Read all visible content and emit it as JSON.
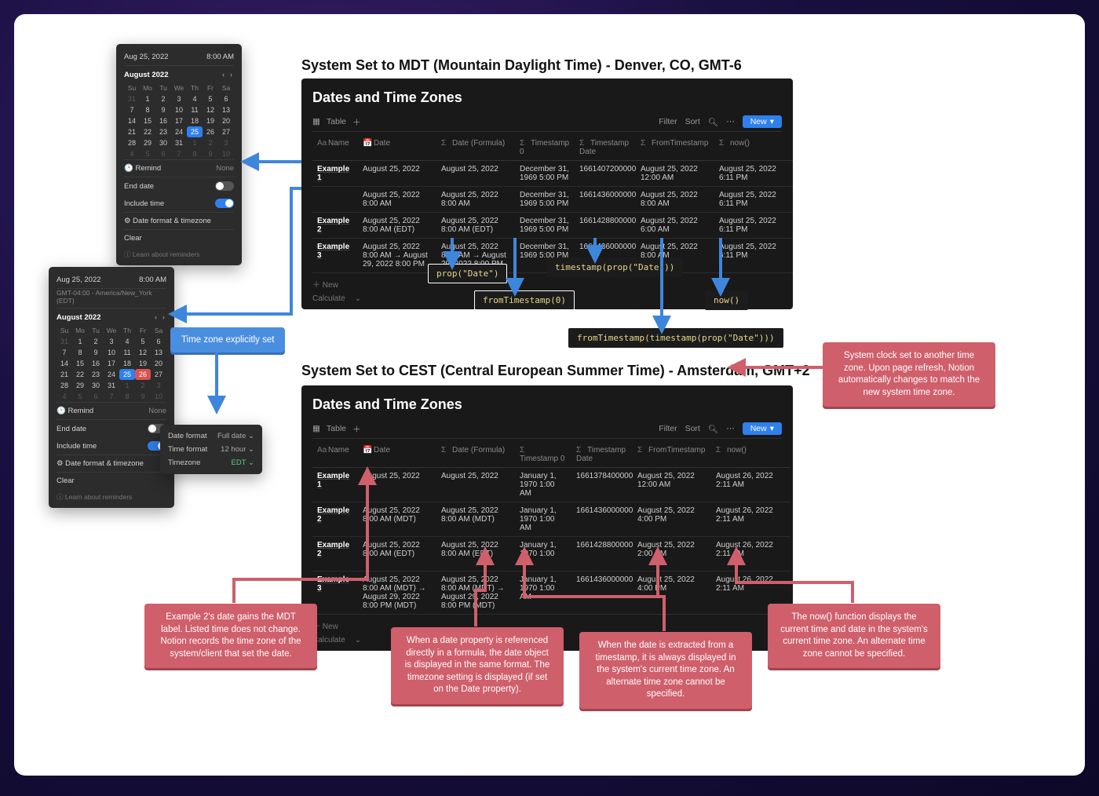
{
  "titles": {
    "mdt": "System Set to MDT (Mountain Daylight Time) - Denver, CO, GMT-6",
    "cest": "System Set to CEST (Central European Summer Time) - Amsterdam, GMT+2"
  },
  "db": {
    "title": "Dates and Time Zones",
    "view": "Table",
    "toolbar": {
      "filter": "Filter",
      "sort": "Sort",
      "new": "New"
    },
    "headers": {
      "name": "Name",
      "date": "Date",
      "date_formula": "Date (Formula)",
      "ts0": "Timestamp 0",
      "ts_date": "Timestamp Date",
      "from_ts": "FromTimestamp",
      "now": "now()"
    },
    "footer": {
      "new": "New",
      "calc": "Calculate"
    }
  },
  "mdt_rows": [
    {
      "name": "Example 1",
      "date": "August 25, 2022",
      "date_formula": "August 25, 2022",
      "ts0": "December 31, 1969 5:00 PM",
      "ts_date": "1661407200000",
      "from_ts": "August 25, 2022 12:00 AM",
      "now": "August 25, 2022 6:11 PM"
    },
    {
      "name": "",
      "date": "August 25, 2022 8:00 AM",
      "date_formula": "August 25, 2022 8:00 AM",
      "ts0": "December 31, 1969 5:00 PM",
      "ts_date": "1661436000000",
      "from_ts": "August 25, 2022 8:00 AM",
      "now": "August 25, 2022 6:11 PM"
    },
    {
      "name": "Example 2",
      "date": "August 25, 2022 8:00 AM (EDT)",
      "date_formula": "August 25, 2022 8:00 AM (EDT)",
      "ts0": "December 31, 1969 5:00 PM",
      "ts_date": "1661428800000",
      "from_ts": "August 25, 2022 6:00 AM",
      "now": "August 25, 2022 6:11 PM"
    },
    {
      "name": "Example 3",
      "date": "August 25, 2022 8:00 AM → August 29, 2022 8:00 PM",
      "date_formula": "August 25, 2022 8:00 AM → August 29, 2022 8:00 PM",
      "ts0": "December 31, 1969 5:00 PM",
      "ts_date": "1661436000000",
      "from_ts": "August 25, 2022 8:00 AM",
      "now": "August 25, 2022 6:11 PM"
    }
  ],
  "cest_rows": [
    {
      "name": "Example 1",
      "date": "August 25, 2022",
      "date_formula": "August 25, 2022",
      "ts0": "January 1, 1970 1:00 AM",
      "ts_date": "1661378400000",
      "from_ts": "August 25, 2022 12:00 AM",
      "now": "August 26, 2022 2:11 AM"
    },
    {
      "name": "Example 2",
      "date": "August 25, 2022 8:00 AM (MDT)",
      "date_formula": "August 25, 2022 8:00 AM (MDT)",
      "ts0": "January 1, 1970 1:00 AM",
      "ts_date": "1661436000000",
      "from_ts": "August 25, 2022 4:00 PM",
      "now": "August 26, 2022 2:11 AM"
    },
    {
      "name": "Example 2",
      "date": "August 25, 2022 8:00 AM (EDT)",
      "date_formula": "August 25, 2022 8:00 AM (EDT)",
      "ts0": "January 1, 1970 1:00 AM",
      "ts_date": "1661428800000",
      "from_ts": "August 25, 2022 2:00 PM",
      "now": "August 26, 2022 2:11 AM"
    },
    {
      "name": "Example 3",
      "date": "August 25, 2022 8:00 AM (MDT) → August 29, 2022 8:00 PM (MDT)",
      "date_formula": "August 25, 2022 8:00 AM (MDT) → August 29, 2022 8:00 PM (MDT)",
      "ts0": "January 1, 1970 1:00 AM",
      "ts_date": "1661436000000",
      "from_ts": "August 25, 2022 4:00 PM",
      "now": "August 26, 2022 2:11 AM"
    }
  ],
  "picker1": {
    "date": "Aug 25, 2022",
    "time": "8:00 AM",
    "month": "August 2022",
    "remind_label": "Remind",
    "remind_value": "None",
    "end_date": "End date",
    "include_time": "Include time",
    "fmt": "Date format & timezone",
    "clear": "Clear",
    "learn": "Learn about reminders",
    "dow": [
      "Su",
      "Mo",
      "Tu",
      "We",
      "Th",
      "Fr",
      "Sa"
    ],
    "grid": [
      [
        "31",
        "1",
        "2",
        "3",
        "4",
        "5",
        "6"
      ],
      [
        "7",
        "8",
        "9",
        "10",
        "11",
        "12",
        "13"
      ],
      [
        "14",
        "15",
        "16",
        "17",
        "18",
        "19",
        "20"
      ],
      [
        "21",
        "22",
        "23",
        "24",
        "25",
        "26",
        "27"
      ],
      [
        "28",
        "29",
        "30",
        "31",
        "1",
        "2",
        "3"
      ],
      [
        "4",
        "5",
        "6",
        "7",
        "8",
        "9",
        "10"
      ]
    ],
    "selected": "25"
  },
  "picker2": {
    "date": "Aug 25, 2022",
    "time": "8:00 AM",
    "tzline": "GMT-04:00 - America/New_York (EDT)",
    "month": "August 2022",
    "remind_label": "Remind",
    "remind_value": "None",
    "end_date": "End date",
    "include_time": "Include time",
    "fmt": "Date format & timezone",
    "clear": "Clear",
    "learn": "Learn about reminders",
    "dow": [
      "Su",
      "Mo",
      "Tu",
      "We",
      "Th",
      "Fr",
      "Sa"
    ],
    "grid": [
      [
        "31",
        "1",
        "2",
        "3",
        "4",
        "5",
        "6"
      ],
      [
        "7",
        "8",
        "9",
        "10",
        "11",
        "12",
        "13"
      ],
      [
        "14",
        "15",
        "16",
        "17",
        "18",
        "19",
        "20"
      ],
      [
        "21",
        "22",
        "23",
        "24",
        "25",
        "26",
        "27"
      ],
      [
        "28",
        "29",
        "30",
        "31",
        "1",
        "2",
        "3"
      ],
      [
        "4",
        "5",
        "6",
        "7",
        "8",
        "9",
        "10"
      ]
    ],
    "selected": "25",
    "today": "26"
  },
  "sub_options": {
    "date_format_l": "Date format",
    "date_format_v": "Full date",
    "time_format_l": "Time format",
    "time_format_v": "12 hour",
    "timezone_l": "Timezone",
    "timezone_v": "EDT"
  },
  "formulas": {
    "prop_date": "prop(\"Date\")",
    "from_ts_zero": "fromTimestamp(0)",
    "ts_prop": "timestamp(prop(\"Date\"))",
    "from_ts_ts": "fromTimestamp(timestamp(prop(\"Date\")))",
    "now": "now()"
  },
  "callouts": {
    "tz_set": "Time zone explicitly set",
    "system_clock": "System clock set to another time zone. Upon page refresh, Notion automatically changes to match the new system time zone.",
    "mdt_label": "Example 2's date gains the MDT label. Listed time does not change. Notion records the time zone of the system/client that set the date.",
    "formula_ref": "When a date property is referenced directly in a formula, the date object is displayed in the same format. The timezone setting is displayed (if set on the Date property).",
    "timestamp_ex": "When the date is extracted from a timestamp, it is always displayed in the system's current time zone. An alternate time zone cannot be specified.",
    "now_ex": "The now() function displays the current time and date in the system's current time zone. An alternate time zone cannot be specified."
  }
}
